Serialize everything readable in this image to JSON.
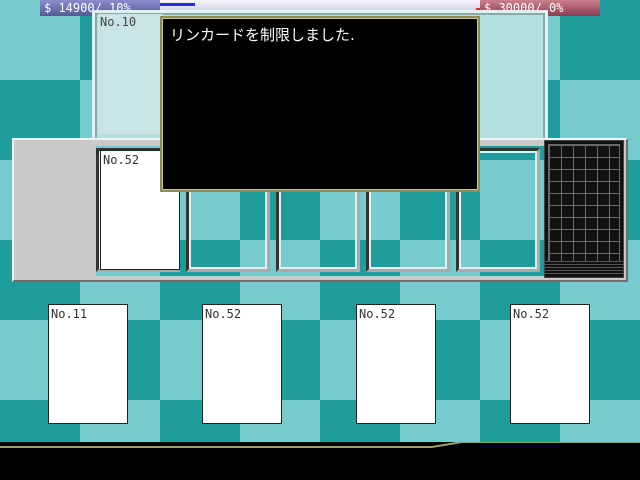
{
  "status": {
    "player_money": "$ 14900/ 10%",
    "opponent_money": "$ 30000/  0%",
    "gauge_fill_fraction": 0.11
  },
  "top_card": {
    "label": "No.10"
  },
  "middle_card": {
    "label": "No.52"
  },
  "hand": [
    {
      "label": "No.11"
    },
    {
      "label": "No.52"
    },
    {
      "label": "No.52"
    },
    {
      "label": "No.52"
    }
  ],
  "message": {
    "text": "リンカードを制限しました."
  },
  "colors": {
    "player_bar": "#545a94",
    "opponent_bar": "#8a3c52",
    "board_teal_dark": "#1f9c9c",
    "board_teal_light": "#76cccc",
    "message_border": "#8c8c5a"
  }
}
